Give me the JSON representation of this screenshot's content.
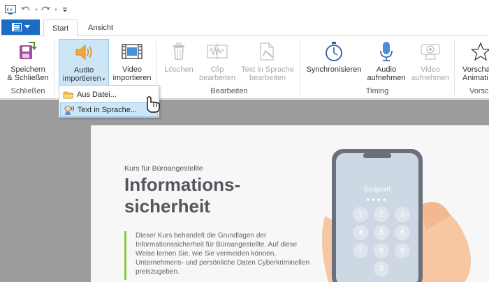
{
  "quick_access": {
    "app_icon": "camtasia-app-icon",
    "undo_icon": "undo-icon",
    "redo_icon": "redo-icon",
    "customize_icon": "customize-dropdown-icon"
  },
  "tabs": {
    "file_icon": "menu-icon",
    "items": [
      {
        "label": "Start",
        "active": true
      },
      {
        "label": "Ansicht",
        "active": false
      }
    ]
  },
  "ribbon": {
    "groups": [
      {
        "label": "Schließen"
      },
      {
        "label": "Bearbeiten"
      },
      {
        "label": "Timing"
      },
      {
        "label": "Vorsc"
      }
    ],
    "buttons": {
      "save_close": "Speichern\n& Schließen",
      "import_audio_line1": "Audio",
      "import_audio_line2": "importieren",
      "import_video_line1": "Video",
      "import_video_line2": "importieren",
      "delete": "Löschen",
      "clip_line1": "Clip",
      "clip_line2": "bearbeiten",
      "tts_edit_line1": "Text in Sprache",
      "tts_edit_line2": "bearbeiten",
      "sync": "Synchronisieren",
      "record_audio_line1": "Audio",
      "record_audio_line2": "aufnehmen",
      "record_video_line1": "Video",
      "record_video_line2": "aufnehmen",
      "preview_line1": "Vorscha",
      "preview_line2": "Animati"
    }
  },
  "dropdown": {
    "items": [
      {
        "label": "Aus Datei...",
        "icon": "folder-icon"
      },
      {
        "label": "Text in Sprache...",
        "icon": "text-to-speech-icon"
      }
    ]
  },
  "slide": {
    "kicker": "Kurs für Büroangestellte",
    "headline_line1": "Informations-",
    "headline_line2": "sicherheit",
    "body": "Dieser Kurs behandelt die Grundlagen der Informationssicherheit für Büroangestellte. Auf diese Weise lernen Sie, wie Sie vermeiden können, Unternehmens- und persönliche Daten Cyberkriminellen preiszugeben.",
    "phone_locked_label": "Gesperrt",
    "keypad": [
      "1",
      "2",
      "3",
      "4",
      "5",
      "6",
      "7",
      "8",
      "9",
      "0"
    ]
  },
  "colors": {
    "file_tab": "#1c6cc4",
    "selected_button": "#cde6f7",
    "accent_bar": "#8cc63f",
    "headline": "#52565e"
  }
}
